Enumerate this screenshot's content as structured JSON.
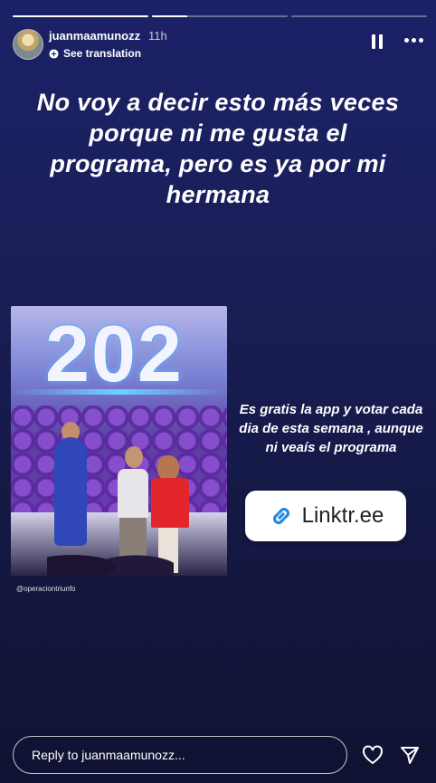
{
  "progress": [
    1.0,
    0.26,
    0.0
  ],
  "header": {
    "username": "juanmaamunozz",
    "time": "11h",
    "translate_label": "See translation"
  },
  "story": {
    "headline": "No voy a decir esto más veces porque ni me gusta el programa, pero es ya por mi hermana",
    "photo_digits": "202",
    "photo_credit": "@operaciontriunfo",
    "side_text": "Es gratis la app y votar cada dia de esta semana , aunque ni veaís el programa",
    "link_label": "Linktr.ee"
  },
  "footer": {
    "reply_placeholder": "Reply to juanmaamunozz..."
  },
  "icons": {
    "translate": "globe-icon",
    "pause": "pause-icon",
    "more": "more-options-icon",
    "link": "link-icon",
    "like": "heart-icon",
    "share": "send-icon"
  },
  "colors": {
    "background": "#1a1f5a",
    "link_icon": "#1f8ae0"
  }
}
